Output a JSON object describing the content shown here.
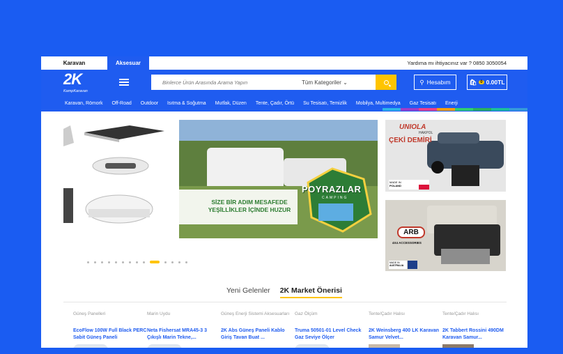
{
  "top_tabs": [
    "Karavan",
    "Aksesuar"
  ],
  "help_text": "Yardıma mı ihtiyacınız var ? 0850 3050054",
  "logo": {
    "main": "2K",
    "sub": "KampKaravan"
  },
  "search": {
    "placeholder": "Binlerce Ürün Arasında Arama Yapın",
    "category": "Tüm Kategoriler"
  },
  "account_label": "Hesabım",
  "cart": {
    "count": "0",
    "total": "0.00TL"
  },
  "nav_items": [
    "Karavan, Römork",
    "Off-Road",
    "Outdoor",
    "Isıtma & Soğutma",
    "Mutfak, Düzen",
    "Tente, Çadır, Örtü",
    "Su Tesisatı, Temizlik",
    "Mobilya, Multimedya",
    "Gaz Tesisatı",
    "Enerji"
  ],
  "rainbow_colors": [
    "#2bb3e8",
    "#9c3cc9",
    "#e83e8c",
    "#f39c12",
    "#2ecc71",
    "#27ae60",
    "#1abc9c",
    "#3498db"
  ],
  "banner": {
    "line1": "SİZE BİR ADIM MESAFEDE",
    "line2": "YEŞİLLİKLER İÇİNDE HUZUR",
    "brand": "POYRAZLAR",
    "brand_sub": "CAMPING"
  },
  "side_banner1": {
    "brand": "UNIOLA",
    "brand_sub": "HAKPOL",
    "title": "ÇEKİ DEMİRİ",
    "made_in": "MADE IN",
    "country": "POLAND"
  },
  "side_banner2": {
    "brand": "ARB",
    "brand_sub": "4X4 ACCESSORIES",
    "made_in": "MADE IN",
    "country": "AUSTRALIA"
  },
  "carousel": {
    "count": 14,
    "active_index": 9
  },
  "tabs": [
    "Yeni Gelenler",
    "2K Market Önerisi"
  ],
  "products": [
    {
      "category": "Güneş Panelleri",
      "name": "EcoFlow 100W Full Black PERC Sabit Güneş Paneli"
    },
    {
      "category": "Marin Uydu",
      "name": "Neta Fishersat MRA45-3 3 Çıkışlı Marin Tekne,..."
    },
    {
      "category": "Güneş Enerji Sistemi Aksesuarları",
      "name": "2K Abs Güneş Paneli Kablo Giriş Tavan Buat ..."
    },
    {
      "category": "Gaz Ölçüm",
      "name": "Truma 50501-01 Level Check Gaz Seviye Ölçer"
    },
    {
      "category": "Tente/Çadır Halısı",
      "name": "2K Weinsberg 400 LK Karavan Samur Velvet..."
    },
    {
      "category": "Tente/Çadır Halısı",
      "name": "2K Tabbert Rossini 490DM Karavan Samur..."
    }
  ],
  "colors": {
    "brand_blue": "#1f5cf0",
    "accent_yellow": "#ffc400"
  }
}
